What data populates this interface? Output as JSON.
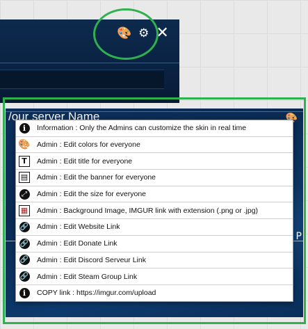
{
  "top_bar": {
    "palette_icon": "palette-icon",
    "settings_icon": "gear-icon",
    "close_icon": "close-icon",
    "palette_glyph": "🎨",
    "settings_glyph": "⚙",
    "close_glyph": "✕"
  },
  "panel": {
    "server_name": "/our server Name",
    "corner_glyph": "🎨",
    "edge_letter": "P"
  },
  "menu": {
    "items": [
      {
        "icon": "info-icon",
        "glyph": "i",
        "style": "circle",
        "label": "Information : Only the Admins can customize the skin in real time"
      },
      {
        "icon": "palette-icon",
        "glyph": "🎨",
        "style": "plain",
        "label": "Admin : Edit colors for everyone"
      },
      {
        "icon": "title-icon",
        "glyph": "T",
        "style": "square",
        "label": "Admin : Edit title for everyone"
      },
      {
        "icon": "banner-icon",
        "glyph": "▤",
        "style": "square",
        "label": "Admin : Edit the banner for everyone"
      },
      {
        "icon": "resize-icon",
        "glyph": "⤢",
        "style": "link",
        "label": "Admin : Edit the size for everyone"
      },
      {
        "icon": "background-image-icon",
        "glyph": "▦",
        "style": "square-red",
        "label": "Admin : Background Image, IMGUR link with extension (.png or .jpg)"
      },
      {
        "icon": "link-icon",
        "glyph": "🔗",
        "style": "link",
        "label": "Admin : Edit Website Link"
      },
      {
        "icon": "link-icon",
        "glyph": "🔗",
        "style": "link",
        "label": "Admin : Edit Donate Link"
      },
      {
        "icon": "link-icon",
        "glyph": "🔗",
        "style": "link",
        "label": "Admin : Edit Discord Serveur Link"
      },
      {
        "icon": "link-icon",
        "glyph": "🔗",
        "style": "link",
        "label": "Admin : Edit Steam Group Link"
      },
      {
        "icon": "info-icon",
        "glyph": "i",
        "style": "circle",
        "label": "COPY link : https://imgur.com/upload"
      }
    ]
  },
  "colors": {
    "highlight": "#2fb14f",
    "panel_bg": "#0c2f5a"
  }
}
